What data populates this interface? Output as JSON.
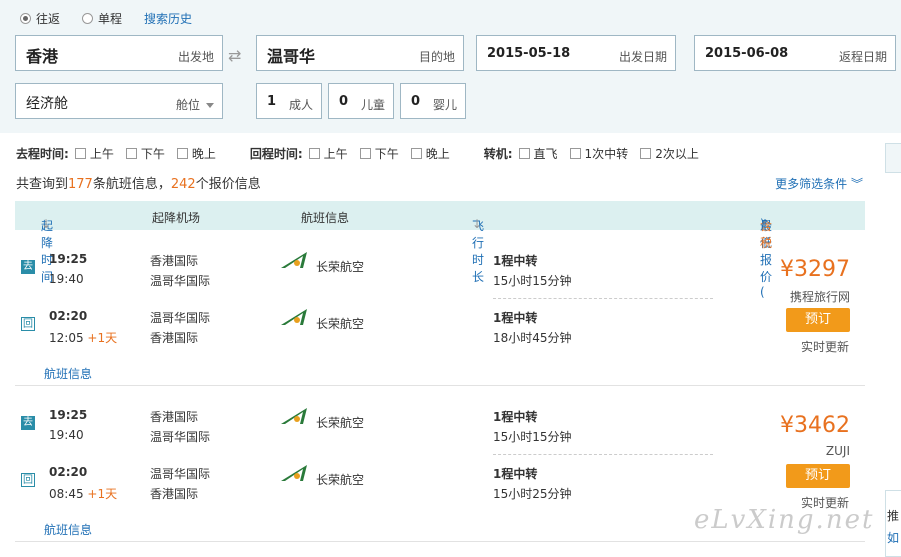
{
  "search": {
    "trip_types": [
      {
        "label": "往返",
        "selected": true
      },
      {
        "label": "单程",
        "selected": false
      }
    ],
    "history_link": "搜索历史",
    "from": {
      "value": "香港",
      "label": "出发地"
    },
    "to": {
      "value": "温哥华",
      "label": "目的地"
    },
    "depart_date": {
      "value": "2015-05-18",
      "label": "出发日期"
    },
    "return_date": {
      "value": "2015-06-08",
      "label": "返程日期"
    },
    "cabin": {
      "value": "经济舱",
      "label": "舱位"
    },
    "adults": {
      "value": "1",
      "label": "成人"
    },
    "children": {
      "value": "0",
      "label": "儿童"
    },
    "infants": {
      "value": "0",
      "label": "婴儿"
    }
  },
  "filters": {
    "depart_time": {
      "title": "去程时间:",
      "options": [
        "上午",
        "下午",
        "晚上"
      ]
    },
    "return_time": {
      "title": "回程时间:",
      "options": [
        "上午",
        "下午",
        "晚上"
      ]
    },
    "transfer": {
      "title": "转机:",
      "options": [
        "直飞",
        "1次中转",
        "2次以上"
      ]
    }
  },
  "summary": {
    "prefix": "共查询到",
    "flight_count": "177",
    "mid": "条航班信息，",
    "price_count": "242",
    "suffix": "个报价信息",
    "more_filters": "更多筛选条件"
  },
  "table_head": {
    "time": "起降时间",
    "airport": "起降机场",
    "flight_info": "航班信息",
    "duration": "飞行时长",
    "price": "最低报价(",
    "price_tax": "含税",
    "price_close": ")"
  },
  "flights": [
    {
      "outbound": {
        "tag": "去",
        "dep_time": "19:25",
        "arr_time": "19:40",
        "arr_plus": "",
        "dep_airport": "香港国际",
        "arr_airport": "温哥华国际",
        "airline": "长荣航空",
        "stops": "1程中转",
        "duration": "15小时15分钟"
      },
      "inbound": {
        "tag": "回",
        "dep_time": "02:20",
        "arr_time": "12:05",
        "arr_plus": "+1天",
        "dep_airport": "温哥华国际",
        "arr_airport": "香港国际",
        "airline": "长荣航空",
        "stops": "1程中转",
        "duration": "18小时45分钟"
      },
      "price": "¥3297",
      "vendor": "携程旅行网",
      "book": "预订",
      "update": "实时更新",
      "info_link": "航班信息"
    },
    {
      "outbound": {
        "tag": "去",
        "dep_time": "19:25",
        "arr_time": "19:40",
        "arr_plus": "",
        "dep_airport": "香港国际",
        "arr_airport": "温哥华国际",
        "airline": "长荣航空",
        "stops": "1程中转",
        "duration": "15小时15分钟"
      },
      "inbound": {
        "tag": "回",
        "dep_time": "02:20",
        "arr_time": "08:45",
        "arr_plus": "+1天",
        "dep_airport": "温哥华国际",
        "arr_airport": "香港国际",
        "airline": "长荣航空",
        "stops": "1程中转",
        "duration": "15小时25分钟"
      },
      "price": "¥3462",
      "vendor": "ZUJI",
      "book": "预订",
      "update": "实时更新",
      "info_link": "航班信息"
    }
  ],
  "watermark": "eLvXing.net",
  "side_chars": [
    "推",
    "如"
  ],
  "colors": {
    "accent_orange": "#e8711f",
    "button_orange": "#f29a1a",
    "link_blue": "#1f6fb5",
    "header_teal": "#dcf0f0"
  }
}
